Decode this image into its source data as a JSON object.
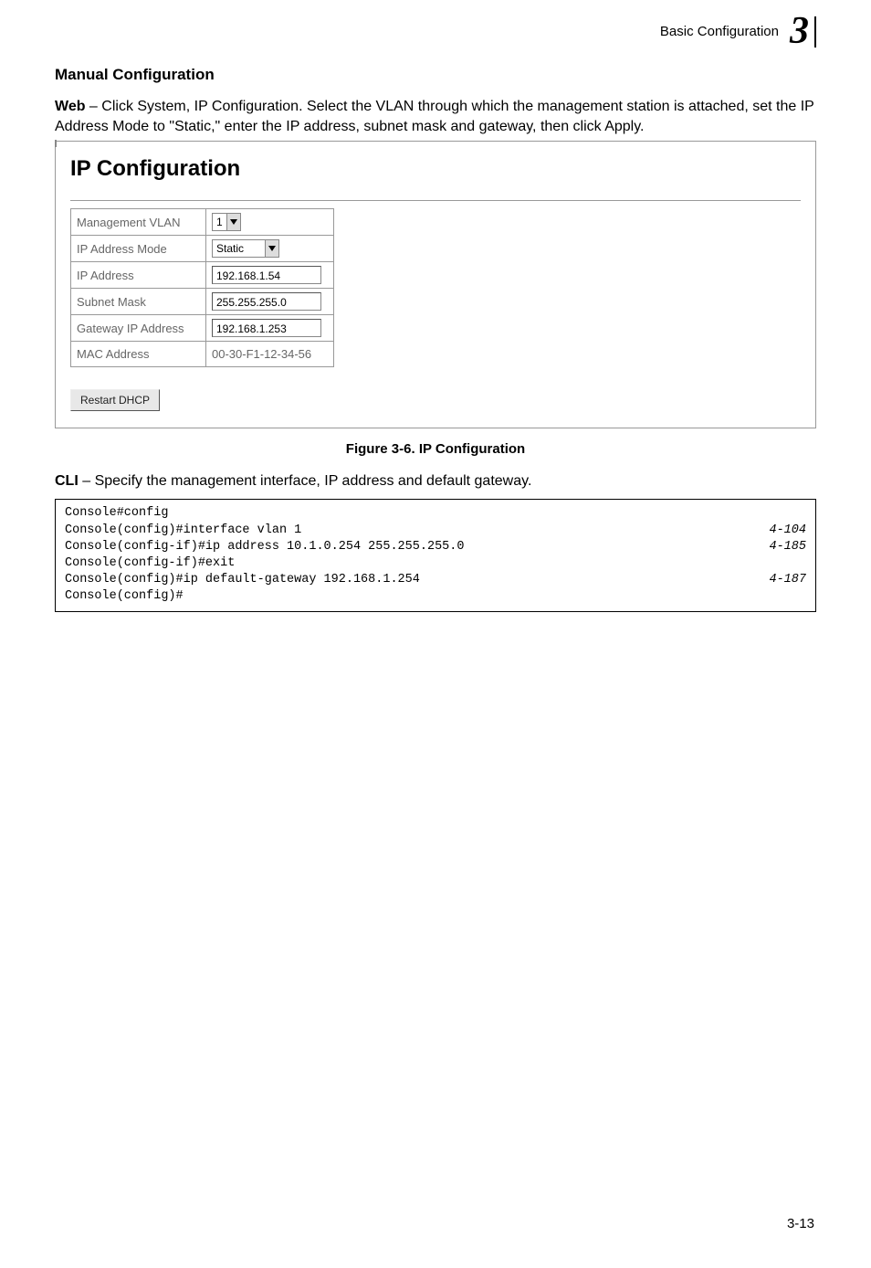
{
  "header": {
    "section": "Basic Configuration",
    "chapter": "3"
  },
  "heading": "Manual Configuration",
  "intro": {
    "label": "Web",
    "text": " – Click System, IP Configuration. Select the VLAN through which the management station is attached, set the IP Address Mode to \"Static,\" enter the IP address, subnet mask and gateway, then click Apply."
  },
  "panel": {
    "title": "IP Configuration",
    "rows": {
      "mgmt_vlan_label": "Management VLAN",
      "mgmt_vlan_value": "1",
      "mode_label": "IP Address Mode",
      "mode_value": "Static",
      "ip_label": "IP Address",
      "ip_value": "192.168.1.54",
      "subnet_label": "Subnet Mask",
      "subnet_value": "255.255.255.0",
      "gateway_label": "Gateway IP Address",
      "gateway_value": "192.168.1.253",
      "mac_label": "MAC Address",
      "mac_value": "00-30-F1-12-34-56"
    },
    "button": "Restart DHCP"
  },
  "figure_caption": "Figure 3-6.  IP Configuration",
  "cli_intro": {
    "label": "CLI",
    "text": " – Specify the management interface, IP address and default gateway."
  },
  "code": {
    "l1": "Console#config",
    "l2": "Console(config)#interface vlan 1",
    "l2ref": "4-104",
    "l3": "Console(config-if)#ip address 10.1.0.254 255.255.255.0",
    "l3ref": "4-185",
    "l4": "Console(config-if)#exit",
    "l5": "Console(config)#ip default-gateway 192.168.1.254",
    "l5ref": "4-187",
    "l6": "Console(config)#"
  },
  "page_number": "3-13"
}
